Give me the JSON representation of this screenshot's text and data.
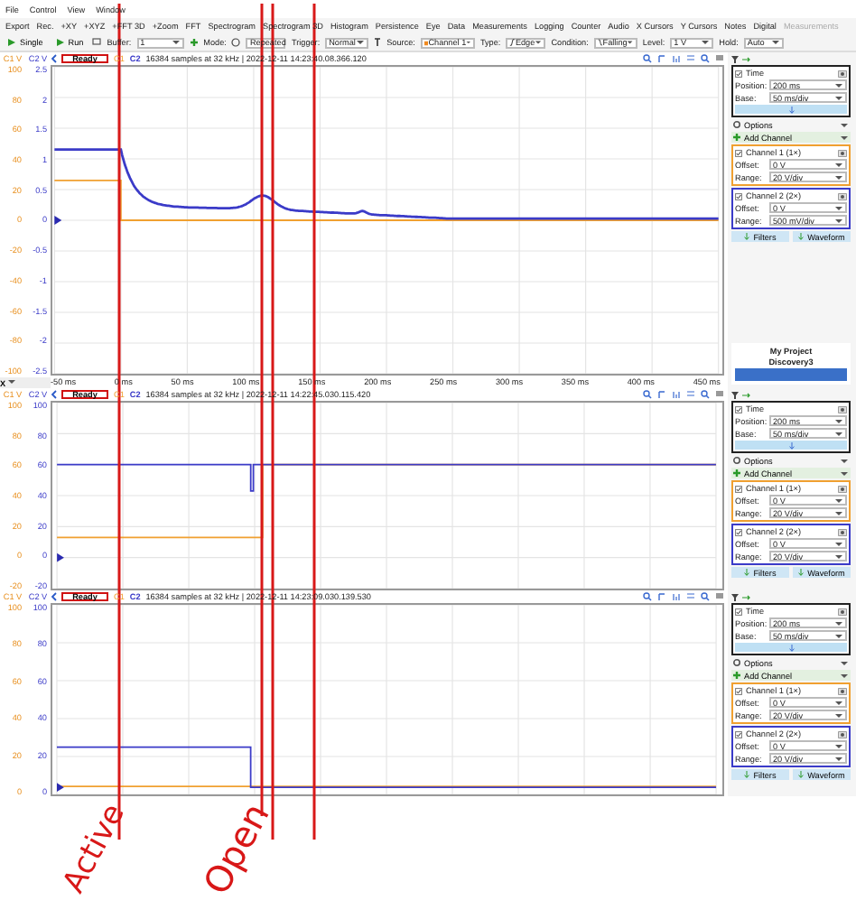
{
  "menu": [
    "File",
    "Control",
    "View",
    "Window"
  ],
  "toolbar": [
    {
      "label": "Export",
      "disabled": false
    },
    {
      "label": "Rec.",
      "disabled": false
    },
    {
      "label": "+XY",
      "disabled": false
    },
    {
      "label": "+XYZ",
      "disabled": false
    },
    {
      "label": "+FFT 3D",
      "disabled": false
    },
    {
      "label": "+Zoom",
      "disabled": false
    },
    {
      "label": "FFT",
      "disabled": false
    },
    {
      "label": "Spectrogram",
      "disabled": false
    },
    {
      "label": "Spectrogram 3D",
      "disabled": false
    },
    {
      "label": "Histogram",
      "disabled": false
    },
    {
      "label": "Persistence",
      "disabled": false
    },
    {
      "label": "Eye",
      "disabled": false
    },
    {
      "label": "Data",
      "disabled": false
    },
    {
      "label": "Measurements",
      "disabled": false
    },
    {
      "label": "Logging",
      "disabled": false
    },
    {
      "label": "Counter",
      "disabled": false
    },
    {
      "label": "Audio",
      "disabled": false
    },
    {
      "label": "X Cursors",
      "disabled": false
    },
    {
      "label": "Y Cursors",
      "disabled": false
    },
    {
      "label": "Notes",
      "disabled": false
    },
    {
      "label": "Digital",
      "disabled": false
    },
    {
      "label": "Measurements",
      "disabled": true
    }
  ],
  "controls": {
    "single": "Single",
    "run": "Run",
    "buffer_label": "Buffer:",
    "buffer": "1",
    "mode_label": "Mode:",
    "mode": "Repeated",
    "trigger_label": "Trigger:",
    "trigger": "Normal",
    "source_label": "Source:",
    "source": "Channel 1",
    "type_label": "Type:",
    "type": "Edge",
    "condition_label": "Condition:",
    "condition": "Falling",
    "level_label": "Level:",
    "level": "1 V",
    "hold_label": "Hold:",
    "hold": "Auto"
  },
  "panes": [
    {
      "c1_axis": "C1 V",
      "c2_axis": "C2 V",
      "status": "Ready",
      "c1": "C1",
      "c2": "C2",
      "info": "16384 samples at 32 kHz | 2022-12-11 14:23:40.08.366.120",
      "c1_ticks": [
        "100",
        "80",
        "60",
        "40",
        "20",
        "0",
        "-20",
        "-40",
        "-60",
        "-80",
        "-100"
      ],
      "c2_ticks": [
        "2.5",
        "2",
        "1.5",
        "1",
        "0.5",
        "0",
        "-0.5",
        "-1",
        "-1.5",
        "-2",
        "-2.5"
      ],
      "x_button": "X",
      "x_ticks": [
        "-50 ms",
        "0 ms",
        "50 ms",
        "100 ms",
        "150 ms",
        "200 ms",
        "250 ms",
        "300 ms",
        "350 ms",
        "400 ms",
        "450 ms"
      ],
      "time": {
        "title": "Time",
        "position_label": "Position:",
        "position": "200 ms",
        "base_label": "Base:",
        "base": "50 ms/div"
      },
      "options": "Options",
      "add_channel": "Add Channel",
      "channels": [
        {
          "title": "Channel 1 (1×)",
          "offset_label": "Offset:",
          "offset": "0 V",
          "range_label": "Range:",
          "range": "20 V/div",
          "color": "#f0a030"
        },
        {
          "title": "Channel 2 (2×)",
          "offset_label": "Offset:",
          "offset": "0 V",
          "range_label": "Range:",
          "range": "500 mV/div",
          "color": "#3b3bc8"
        }
      ],
      "filters": "Filters",
      "waveform": "Waveform",
      "device": {
        "project": "My Project",
        "name": "Discovery3"
      }
    },
    {
      "c1_axis": "C1 V",
      "c2_axis": "C2 V",
      "status": "Ready",
      "c1": "C1",
      "c2": "C2",
      "info": "16384 samples at 32 kHz | 2022-12-11 14:22:45.030.115.420",
      "c1_ticks": [
        "100",
        "80",
        "60",
        "40",
        "20",
        "0",
        "-20"
      ],
      "c2_ticks": [
        "100",
        "80",
        "60",
        "40",
        "20",
        "0",
        "-20"
      ],
      "time": {
        "title": "Time",
        "position_label": "Position:",
        "position": "200 ms",
        "base_label": "Base:",
        "base": "50 ms/div"
      },
      "options": "Options",
      "add_channel": "Add Channel",
      "channels": [
        {
          "title": "Channel 1 (1×)",
          "offset_label": "Offset:",
          "offset": "0 V",
          "range_label": "Range:",
          "range": "20 V/div",
          "color": "#f0a030"
        },
        {
          "title": "Channel 2 (2×)",
          "offset_label": "Offset:",
          "offset": "0 V",
          "range_label": "Range:",
          "range": "20 V/div",
          "color": "#3b3bc8"
        }
      ],
      "filters": "Filters",
      "waveform": "Waveform"
    },
    {
      "c1_axis": "C1 V",
      "c2_axis": "C2 V",
      "status": "Ready",
      "c1": "C1",
      "c2": "C2",
      "info": "16384 samples at 32 kHz | 2022-12-11 14:23:09.030.139.530",
      "c1_ticks": [
        "100",
        "80",
        "60",
        "40",
        "20",
        "0"
      ],
      "c2_ticks": [
        "100",
        "80",
        "60",
        "40",
        "20",
        "0"
      ],
      "time": {
        "title": "Time",
        "position_label": "Position:",
        "position": "200 ms",
        "base_label": "Base:",
        "base": "50 ms/div"
      },
      "options": "Options",
      "add_channel": "Add Channel",
      "channels": [
        {
          "title": "Channel 1 (1×)",
          "offset_label": "Offset:",
          "offset": "0 V",
          "range_label": "Range:",
          "range": "20 V/div",
          "color": "#f0a030"
        },
        {
          "title": "Channel 2 (2×)",
          "offset_label": "Offset:",
          "offset": "0 V",
          "range_label": "Range:",
          "range": "20 V/div",
          "color": "#3b3bc8"
        }
      ],
      "filters": "Filters",
      "waveform": "Waveform"
    }
  ],
  "annotations": [
    {
      "text": "Active"
    },
    {
      "text": "Open"
    }
  ]
}
